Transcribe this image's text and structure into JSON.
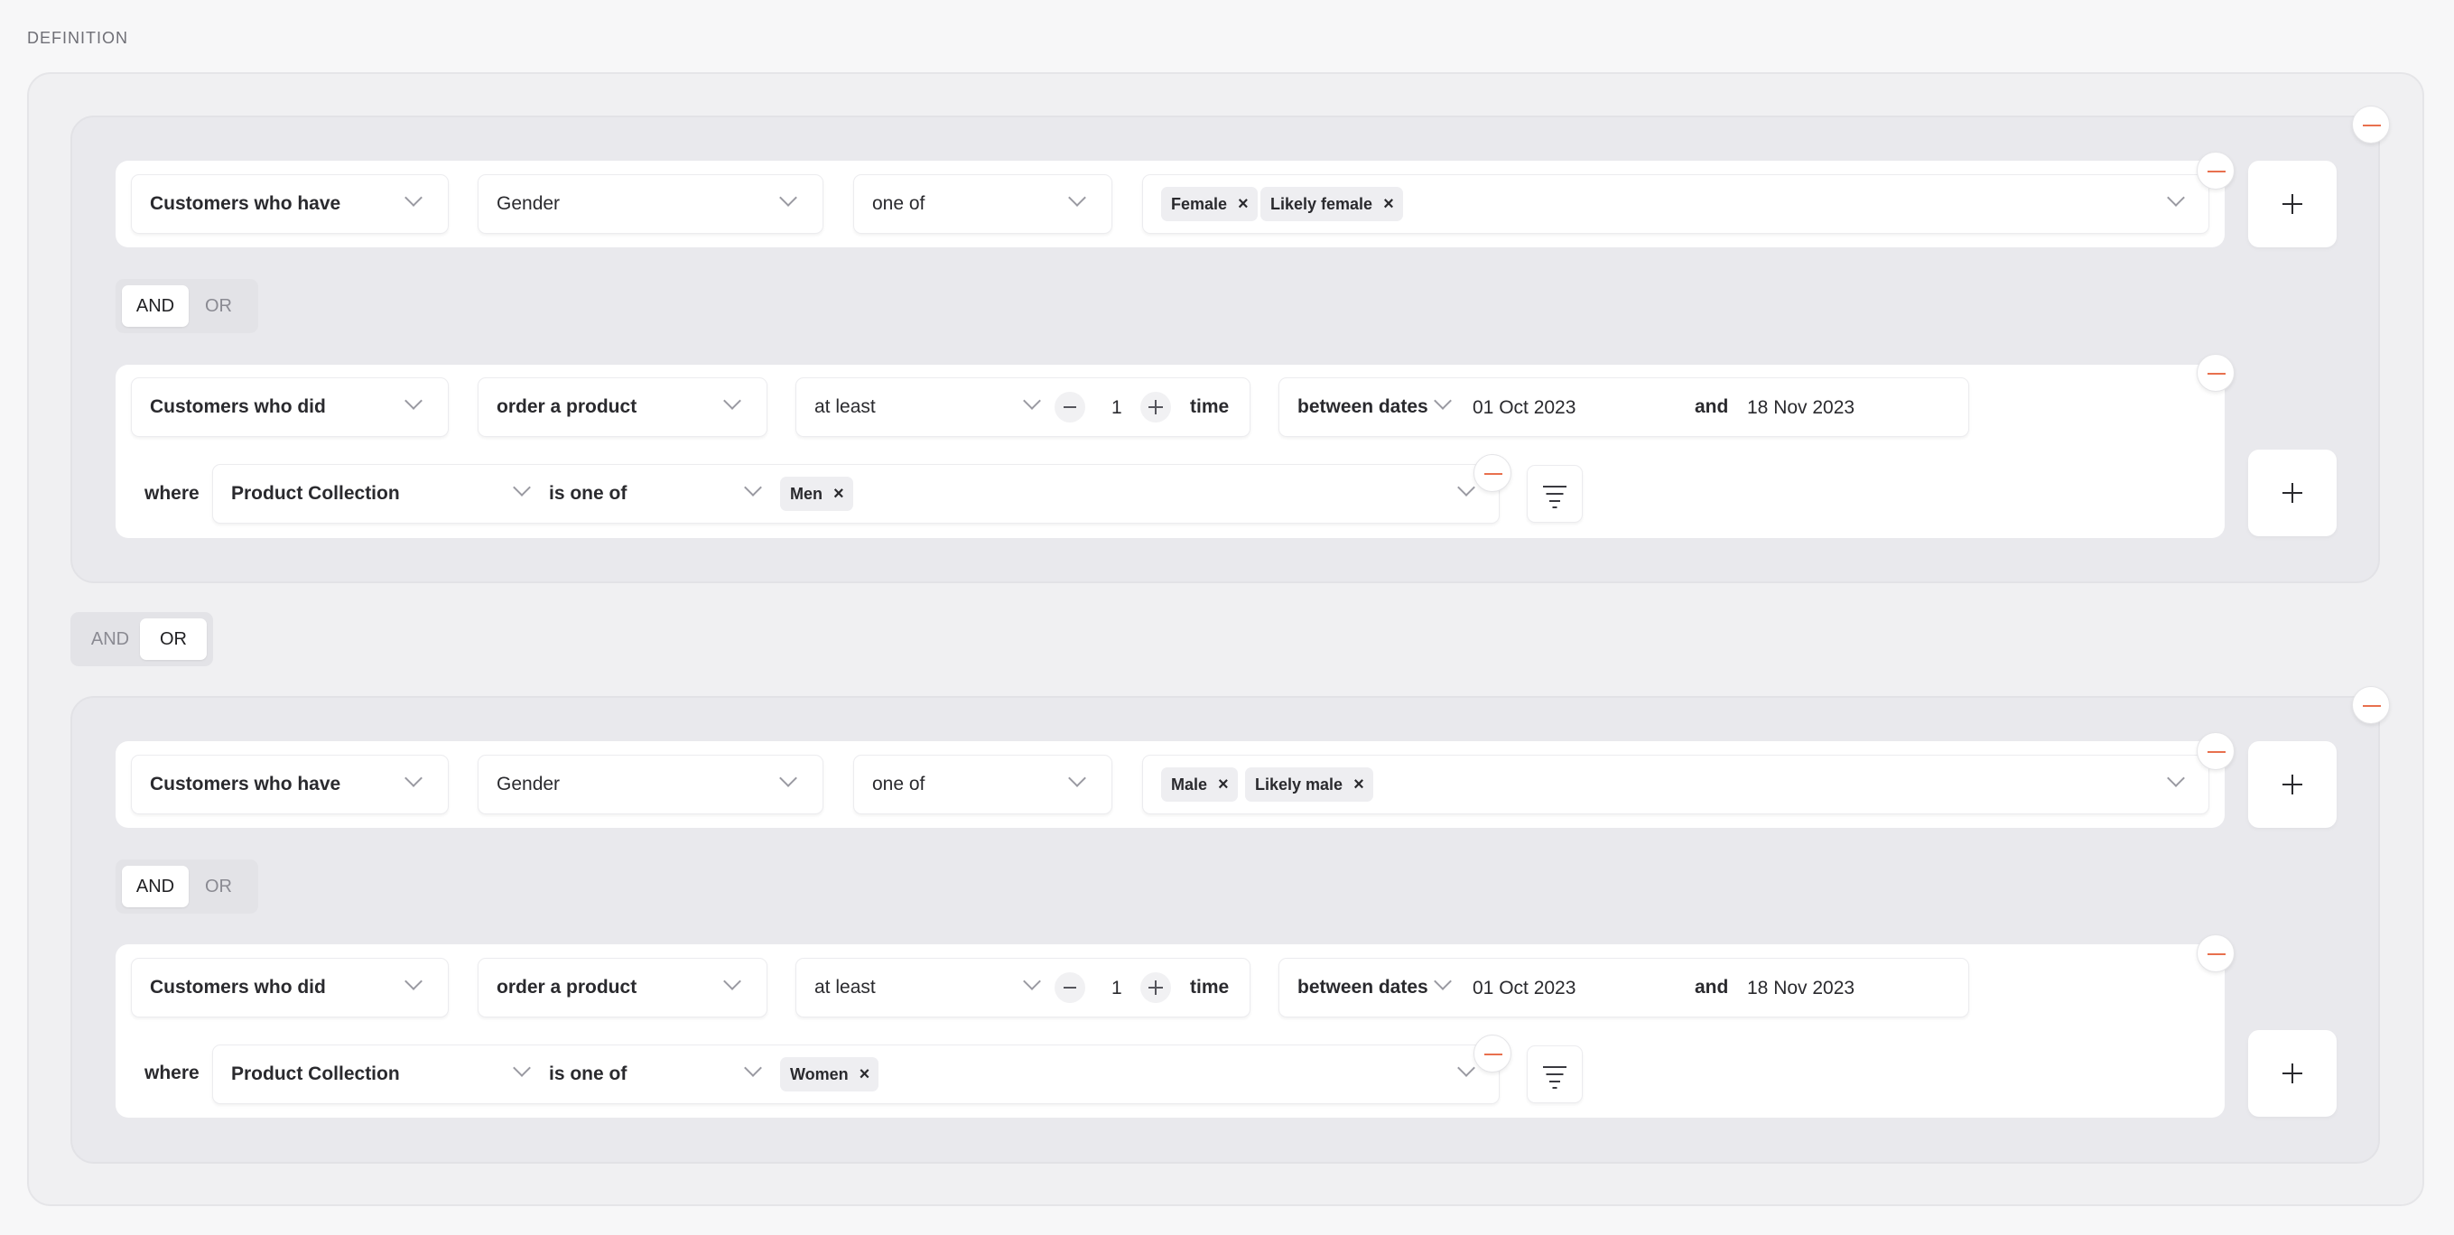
{
  "section_title": "DEFINITION",
  "icons": {
    "remove": "minus-circle-icon",
    "add": "plus-icon",
    "filter": "filter-icon",
    "dropdown": "chevron-down-icon",
    "chip_remove": "close-icon"
  },
  "colors": {
    "remove_accent": "#e8704e"
  },
  "groups": [
    {
      "condition1": {
        "subject": "Customers who have",
        "attribute": "Gender",
        "operator": "one of",
        "chips": [
          "Female",
          "Likely female"
        ]
      },
      "toggle": {
        "and": "AND",
        "or": "OR",
        "selected": "AND"
      },
      "condition2": {
        "subject": "Customers who did",
        "event": "order a product",
        "frequency": "at least",
        "count": "1",
        "count_unit": "time",
        "date_mode": "between dates",
        "start_date": "01 Oct 2023",
        "date_joiner": "and",
        "end_date": "18 Nov 2023",
        "where_label": "where",
        "filter_property": "Product Collection",
        "filter_operator": "is one of",
        "filter_chips": [
          "Men"
        ]
      }
    },
    {
      "condition1": {
        "subject": "Customers who have",
        "attribute": "Gender",
        "operator": "one of",
        "chips": [
          "Male",
          "Likely male"
        ]
      },
      "toggle": {
        "and": "AND",
        "or": "OR",
        "selected": "AND"
      },
      "condition2": {
        "subject": "Customers who did",
        "event": "order a product",
        "frequency": "at least",
        "count": "1",
        "count_unit": "time",
        "date_mode": "between dates",
        "start_date": "01 Oct 2023",
        "date_joiner": "and",
        "end_date": "18 Nov 2023",
        "where_label": "where",
        "filter_property": "Product Collection",
        "filter_operator": "is one of",
        "filter_chips": [
          "Women"
        ]
      }
    }
  ],
  "group_toggle": {
    "and": "AND",
    "or": "OR",
    "selected": "OR"
  }
}
